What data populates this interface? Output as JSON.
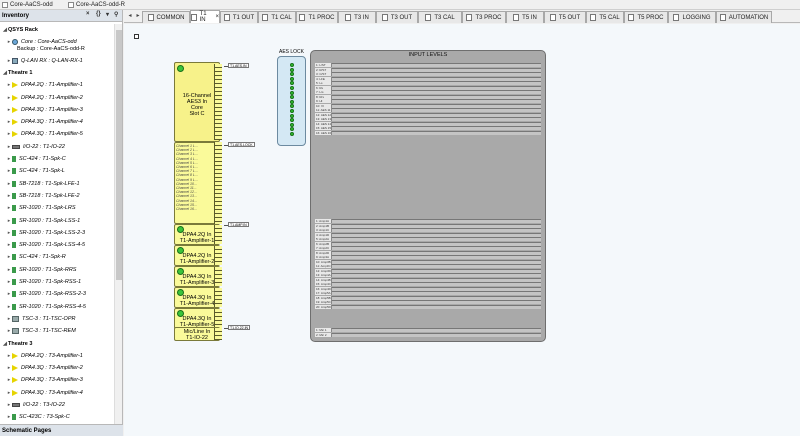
{
  "window": {
    "file_tabs": [
      "Core-AaCS-odd",
      "Core-AaCS-odd-R"
    ]
  },
  "sidebar": {
    "title": "Inventory",
    "controls": [
      "×",
      "{}",
      "▾"
    ],
    "footer": "Schematic Pages",
    "items": [
      {
        "type": "group",
        "label": "QSYS Rack",
        "indent": 0
      },
      {
        "type": "core",
        "label": "Core : Core-AaCS-odd",
        "label2": "Backup : Core-AaCS-odd-R",
        "indent": 1
      },
      {
        "type": "qlan",
        "label": "Q-LAN RX : Q-LAN-RX-1",
        "indent": 1
      },
      {
        "type": "group",
        "label": "Theatre 1",
        "indent": 0
      },
      {
        "type": "amp",
        "label": "DPA4.2Q : T1-Amplifier-1",
        "indent": 1
      },
      {
        "type": "amp",
        "label": "DPA4.2Q : T1-Amplifier-2",
        "indent": 1
      },
      {
        "type": "amp",
        "label": "DPA4.3Q : T1-Amplifier-3",
        "indent": 1
      },
      {
        "type": "amp",
        "label": "DPA4.3Q : T1-Amplifier-4",
        "indent": 1
      },
      {
        "type": "amp",
        "label": "DPA4.3Q : T1-Amplifier-5",
        "indent": 1
      },
      {
        "type": "io",
        "label": "I/O-22 : T1-IO-22",
        "indent": 1
      },
      {
        "type": "spk",
        "label": "SC-424 : T1-Spk-C",
        "indent": 1
      },
      {
        "type": "spk",
        "label": "SC-424 : T1-Spk-L",
        "indent": 1
      },
      {
        "type": "spk",
        "label": "SB-7218 : T1-Spk-LFE-1",
        "indent": 1
      },
      {
        "type": "spk",
        "label": "SB-7218 : T1-Spk-LFE-2",
        "indent": 1
      },
      {
        "type": "spk",
        "label": "SR-1020 : T1-Spk-LRS",
        "indent": 1
      },
      {
        "type": "spk",
        "label": "SR-1020 : T1-Spk-LSS-1",
        "indent": 1
      },
      {
        "type": "spk",
        "label": "SR-1020 : T1-Spk-LSS-2-3",
        "indent": 1
      },
      {
        "type": "spk",
        "label": "SR-1020 : T1-Spk-LSS-4-5",
        "indent": 1
      },
      {
        "type": "spk",
        "label": "SC-424 : T1-Spk-R",
        "indent": 1
      },
      {
        "type": "spk",
        "label": "SR-1020 : T1-Spk-RRS",
        "indent": 1
      },
      {
        "type": "spk",
        "label": "SR-1020 : T1-Spk-RSS-1",
        "indent": 1
      },
      {
        "type": "spk",
        "label": "SR-1020 : T1-Spk-RSS-2-3",
        "indent": 1
      },
      {
        "type": "spk",
        "label": "SR-1020 : T1-Spk-RSS-4-5",
        "indent": 1
      },
      {
        "type": "tsc",
        "label": "TSC-3 : T1-TSC-OPR",
        "indent": 1
      },
      {
        "type": "tsc",
        "label": "TSC-3 : T1-TSC-REM",
        "indent": 1
      },
      {
        "type": "group",
        "label": "Theatre 3",
        "indent": 0
      },
      {
        "type": "amp",
        "label": "DPA4.2Q : T3-Amplifier-1",
        "indent": 1
      },
      {
        "type": "amp",
        "label": "DPA4.3Q : T3-Amplifier-2",
        "indent": 1
      },
      {
        "type": "amp",
        "label": "DPA4.3Q : T3-Amplifier-3",
        "indent": 1
      },
      {
        "type": "amp",
        "label": "DPA4.3Q : T3-Amplifier-4",
        "indent": 1
      },
      {
        "type": "io",
        "label": "I/O-22 : T3-IO-22",
        "indent": 1
      },
      {
        "type": "spk",
        "label": "SC-423C : T3-Spk-C",
        "indent": 1
      }
    ]
  },
  "page_tabs": [
    "COMMON",
    "T1 IN",
    "T1 OUT",
    "T1 CAL",
    "T1 PROC",
    "T3 IN",
    "T3 OUT",
    "T3 CAL",
    "T3 PROC",
    "T5 IN",
    "T5 OUT",
    "T5 CAL",
    "T5 PROC",
    "LOGGING",
    "AUTOMATION"
  ],
  "active_tab": "T1 IN",
  "schematic": {
    "core_block": {
      "line1": "16-Channel",
      "line2": "AES3 In",
      "line3": "Core",
      "line4": "Slot C"
    },
    "core_tag": "T1.AES.IN",
    "channels_tag": "T1.AES.LOCK",
    "channels": [
      "Channel 1 L...",
      "Channel 2 L...",
      "Channel 3 L...",
      "Channel 4 L...",
      "Channel 5 L...",
      "Channel 6 L...",
      "Channel 7 L...",
      "Channel 8 L...",
      "Channel 9 L...",
      "Channel 10...",
      "Channel 11...",
      "Channel 12...",
      "Channel 13...",
      "Channel 14...",
      "Channel 15...",
      "Channel 16..."
    ],
    "amp_blocks": [
      {
        "line1": "DPA4.2Q In",
        "line2": "T1-Amplifier-1"
      },
      {
        "line1": "DPA4.2Q In",
        "line2": "T1-Amplifier-2"
      },
      {
        "line1": "DPA4.3Q In",
        "line2": "T1-Amplifier-3"
      },
      {
        "line1": "DPA4.3Q In",
        "line2": "T1-Amplifier-4"
      },
      {
        "line1": "DPA4.3Q In",
        "line2": "T1-Amplifier-5"
      }
    ],
    "amp_tag": "T1.AMP.IN",
    "mic_block": {
      "line1": "Mic/Line In",
      "line2": "T1-IO-22"
    },
    "mic_tag": "T1.IO.22.IN",
    "aes_lock_title": "AES LOCK",
    "aes_lock_count": 16,
    "input_levels_title": "INPUT LEVELS",
    "input_level_labels_a": [
      "1: L/ST",
      "2: R/ST",
      "3: C/ST",
      "4: LFE",
      "5: Ls",
      "6: Rs",
      "7: Lrs",
      "8: Rrs",
      "9: HI",
      "10: VI",
      "11: AES 11",
      "12: AES 12",
      "13: AES 13",
      "14: AES 14",
      "15: AES 15",
      "16: AES 16"
    ],
    "input_level_labels_b": [
      "1: Amp1A",
      "2: Amp1B",
      "3: Amp1C",
      "4: Amp1D",
      "5: Amp2A",
      "6: Amp2B",
      "7: Amp2C",
      "8: Amp2D",
      "9: Amp3A",
      "10: Amp3B",
      "11: Amp3C",
      "12: Amp3D",
      "13: Amp4A",
      "14: Amp4B",
      "15: Amp4C",
      "16: Amp4D",
      "17: Amp5A",
      "18: Amp5B",
      "19: Amp5C",
      "20: Amp5D"
    ],
    "input_level_labels_c": [
      "1: Mic 1",
      "2: Mic 2"
    ]
  }
}
